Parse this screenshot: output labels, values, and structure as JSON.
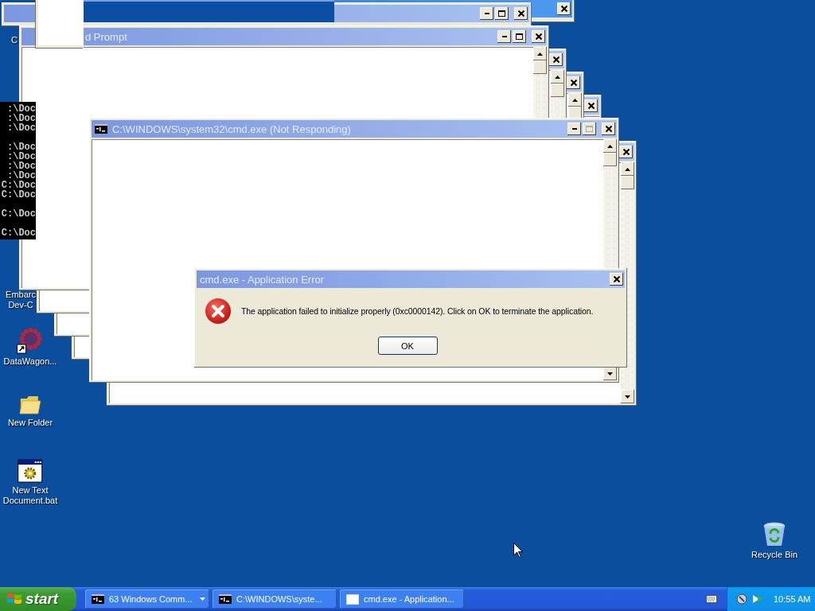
{
  "desktop_icons": [
    {
      "kind": "covered",
      "lines": [
        "C"
      ]
    },
    {
      "kind": "covered",
      "lines": [
        "Embarc",
        "Dev-C"
      ]
    },
    {
      "kind": "shortcut",
      "lines": [
        "DataWagon..."
      ]
    },
    {
      "kind": "folder",
      "lines": [
        "New Folder"
      ]
    },
    {
      "kind": "batch",
      "lines": [
        "New Text",
        "Document.bat"
      ]
    },
    {
      "kind": "recycle-bin",
      "lines": [
        "Recycle Bin"
      ]
    }
  ],
  "back_window": {
    "title": "d Prompt"
  },
  "console": {
    "blocks": [
      [
        ":\\Doc",
        ":\\Doc",
        ":\\Doc"
      ],
      [
        ":\\Doc",
        ":\\Doc",
        ":\\Doc",
        ":\\Doc",
        "C:\\Doc",
        "C:\\Doc"
      ],
      [
        "C:\\Doc"
      ],
      [
        "C:\\Doc"
      ]
    ]
  },
  "main_window": {
    "title": "C:\\WINDOWS\\system32\\cmd.exe (Not Responding)",
    "maximize_disabled": true
  },
  "dialog": {
    "title": "cmd.exe - Application Error",
    "message": "The application failed to initialize properly (0xc0000142). Click on OK to terminate the application.",
    "button": "OK"
  },
  "taskbar": {
    "start": "start",
    "tasks": [
      {
        "kind": "group",
        "label": "63 Windows Comm..."
      },
      {
        "kind": "console",
        "label": "C:\\WINDOWS\\syste..."
      },
      {
        "kind": "window",
        "label": "cmd.exe - Application..."
      }
    ],
    "clock": "10:55 AM"
  }
}
